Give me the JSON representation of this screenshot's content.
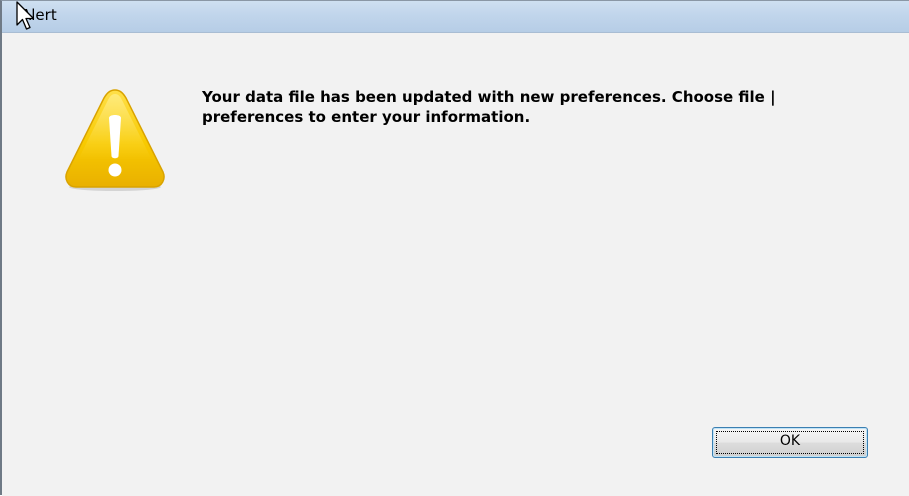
{
  "window": {
    "title": "Alert"
  },
  "dialog": {
    "message": "Your data file has been updated with new preferences. Choose file | preferences to enter your information.",
    "icon": "warning-icon",
    "ok_label": "OK"
  },
  "colors": {
    "titlebar": "#c2d6ec",
    "client_background": "#f2f2f2",
    "warning_yellow": "#f5c400",
    "button_border": "#3c7fb1"
  }
}
